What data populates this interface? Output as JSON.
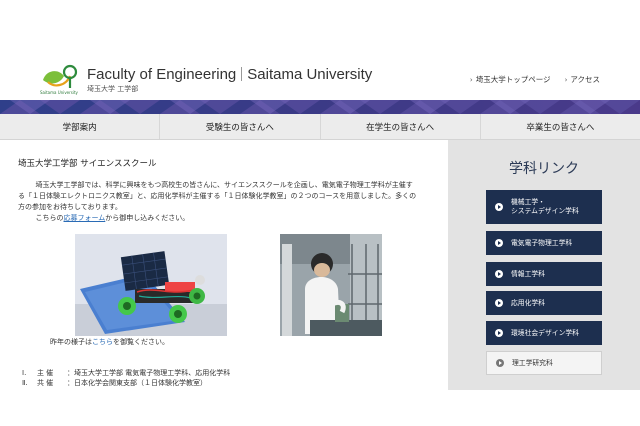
{
  "header": {
    "logo_caption": "Saitama University",
    "title_en_left": "Faculty of Engineering",
    "title_en_right": "Saitama University",
    "title_jp": "埼玉大学 工学部",
    "links": [
      {
        "label": "埼玉大学トップページ"
      },
      {
        "label": "アクセス"
      }
    ]
  },
  "nav": {
    "items": [
      {
        "label": "学部案内"
      },
      {
        "label": "受験生の皆さんへ"
      },
      {
        "label": "在学生の皆さんへ"
      },
      {
        "label": "卒業生の皆さんへ"
      }
    ]
  },
  "main": {
    "title": "埼玉大学工学部 サイエンススクール",
    "intro": "埼玉大学工学部では、科学に興味をもつ高校生の皆さんに、サイエンススクールを企画し、電気電子物理工学科が主催する「１日体験エレクトロニクス教室」と、応用化学科が主催する「１日体験化学教室」の２つのコースを用意しました。多くの方の参加をお待ちしております。",
    "apply_pre": "こちらの",
    "apply_link": "応募フォーム",
    "apply_post": "から御申し込みください。",
    "caption_pre": "昨年の様子は",
    "caption_link": "こちら",
    "caption_post": "を御覧ください。",
    "info": [
      {
        "num": "Ⅰ.",
        "label": "主催",
        "value": "：埼玉大学工学部 電気電子物理工学科、応用化学科"
      },
      {
        "num": "Ⅱ.",
        "label": "共催",
        "value": "：日本化学会関東支部（１日体験化学教室）"
      }
    ]
  },
  "sidebar": {
    "title": "学科リンク",
    "items": [
      {
        "label1": "機械工学・",
        "label2": "システムデザイン学科"
      },
      {
        "label1": "電気電子物理工学科",
        "label2": ""
      },
      {
        "label1": "情報工学科",
        "label2": ""
      },
      {
        "label1": "応用化学科",
        "label2": ""
      },
      {
        "label1": "環境社会デザイン学科",
        "label2": ""
      },
      {
        "label1": "理工学研究科",
        "label2": ""
      }
    ]
  }
}
